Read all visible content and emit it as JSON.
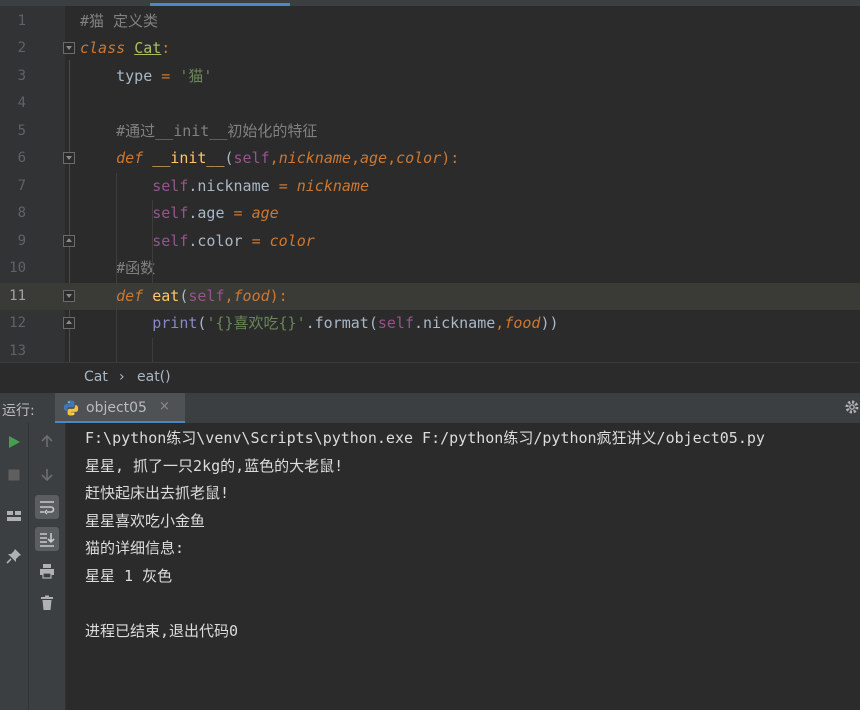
{
  "editor": {
    "lines": [
      {
        "n": "1",
        "parts": [
          {
            "t": "#猫 定义类",
            "c": "cmt"
          }
        ]
      },
      {
        "n": "2",
        "parts": [
          {
            "t": "class",
            "c": "cls"
          },
          {
            "t": " ",
            "c": ""
          },
          {
            "t": "Cat",
            "c": "clsname"
          },
          {
            "t": ":",
            "c": "kw"
          }
        ]
      },
      {
        "n": "3",
        "parts": [
          {
            "t": "    type ",
            "c": ""
          },
          {
            "t": "=",
            "c": "kw"
          },
          {
            "t": " ",
            "c": ""
          },
          {
            "t": "'猫'",
            "c": "str"
          }
        ]
      },
      {
        "n": "4",
        "parts": []
      },
      {
        "n": "5",
        "parts": [
          {
            "t": "    ",
            "c": ""
          },
          {
            "t": "#通过__init__初始化的特征",
            "c": "cmt"
          }
        ]
      },
      {
        "n": "6",
        "parts": [
          {
            "t": "    ",
            "c": ""
          },
          {
            "t": "def",
            "c": "kwdef"
          },
          {
            "t": " ",
            "c": ""
          },
          {
            "t": "__init__",
            "c": "fn"
          },
          {
            "t": "(",
            "c": ""
          },
          {
            "t": "self",
            "c": "slf"
          },
          {
            "t": ",",
            "c": "kw"
          },
          {
            "t": "nickname",
            "c": "ital"
          },
          {
            "t": ",",
            "c": "kw"
          },
          {
            "t": "age",
            "c": "ital"
          },
          {
            "t": ",",
            "c": "kw"
          },
          {
            "t": "color",
            "c": "ital"
          },
          {
            "t": "):",
            "c": "kw"
          }
        ]
      },
      {
        "n": "7",
        "parts": [
          {
            "t": "        ",
            "c": ""
          },
          {
            "t": "self",
            "c": "slf"
          },
          {
            "t": ".nickname ",
            "c": ""
          },
          {
            "t": "=",
            "c": "kw"
          },
          {
            "t": " ",
            "c": ""
          },
          {
            "t": "nickname",
            "c": "ital"
          }
        ]
      },
      {
        "n": "8",
        "parts": [
          {
            "t": "        ",
            "c": ""
          },
          {
            "t": "self",
            "c": "slf"
          },
          {
            "t": ".age ",
            "c": ""
          },
          {
            "t": "=",
            "c": "kw"
          },
          {
            "t": " ",
            "c": ""
          },
          {
            "t": "age",
            "c": "ital"
          }
        ]
      },
      {
        "n": "9",
        "parts": [
          {
            "t": "        ",
            "c": ""
          },
          {
            "t": "self",
            "c": "slf"
          },
          {
            "t": ".color ",
            "c": ""
          },
          {
            "t": "=",
            "c": "kw"
          },
          {
            "t": " ",
            "c": ""
          },
          {
            "t": "color",
            "c": "ital"
          }
        ]
      },
      {
        "n": "10",
        "parts": [
          {
            "t": "    ",
            "c": ""
          },
          {
            "t": "#函数",
            "c": "cmt"
          }
        ]
      },
      {
        "n": "11",
        "parts": [
          {
            "t": "    ",
            "c": ""
          },
          {
            "t": "def",
            "c": "kwdef"
          },
          {
            "t": " ",
            "c": ""
          },
          {
            "t": "eat",
            "c": "fn"
          },
          {
            "t": "(",
            "c": ""
          },
          {
            "t": "self",
            "c": "slf"
          },
          {
            "t": ",",
            "c": "kw"
          },
          {
            "t": "food",
            "c": "ital"
          },
          {
            "t": "):",
            "c": "kw"
          }
        ]
      },
      {
        "n": "12",
        "parts": [
          {
            "t": "        ",
            "c": ""
          },
          {
            "t": "print",
            "c": "builtin"
          },
          {
            "t": "(",
            "c": ""
          },
          {
            "t": "'{}喜欢吃{}'",
            "c": "str"
          },
          {
            "t": ".format(",
            "c": ""
          },
          {
            "t": "self",
            "c": "slf"
          },
          {
            "t": ".nickname",
            "c": ""
          },
          {
            "t": ",",
            "c": "kw"
          },
          {
            "t": "food",
            "c": "ital"
          },
          {
            "t": "))",
            "c": ""
          }
        ]
      },
      {
        "n": "13",
        "parts": []
      }
    ],
    "current_line": "11"
  },
  "breadcrumb": {
    "items": [
      "Cat",
      "›",
      "eat()"
    ]
  },
  "run_panel": {
    "label": "运行:",
    "tab_name": "object05",
    "tab_close": "×"
  },
  "console": {
    "lines": [
      "F:\\python练习\\venv\\Scripts\\python.exe F:/python练习/python疯狂讲义/object05.py",
      "星星, 抓了一只2kg的,蓝色的大老鼠!",
      "赶快起床出去抓老鼠!",
      "星星喜欢吃小金鱼",
      "猫的详细信息:",
      "星星 1 灰色",
      "",
      "进程已结束,退出代码0"
    ]
  },
  "colors": {
    "run_green": "#499c54",
    "accent_blue": "#4a88c7",
    "python_blue": "#3d7ab3",
    "python_yellow": "#f0c33c"
  },
  "icons": {
    "sidebar_left": [
      "run-icon",
      "stop-icon",
      "layout-icon",
      "pin-icon"
    ],
    "sidebar_right": [
      "arrow-up-icon",
      "arrow-down-icon",
      "soft-wrap-icon",
      "scroll-to-end-icon",
      "print-icon",
      "trash-icon"
    ]
  }
}
